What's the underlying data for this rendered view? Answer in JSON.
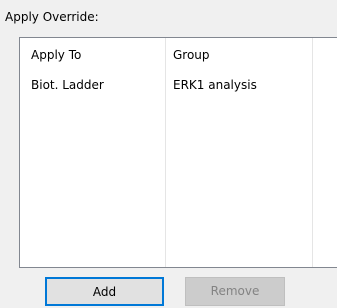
{
  "group_label": "Apply Override:",
  "list": {
    "columns": [
      "Apply To",
      "Group"
    ],
    "rows": [
      [
        "Biot. Ladder",
        "ERK1 analysis"
      ]
    ]
  },
  "buttons": {
    "add": "Add",
    "remove": "Remove"
  },
  "colors": {
    "focus_border": "#0078d7",
    "disabled_text": "#838383"
  }
}
